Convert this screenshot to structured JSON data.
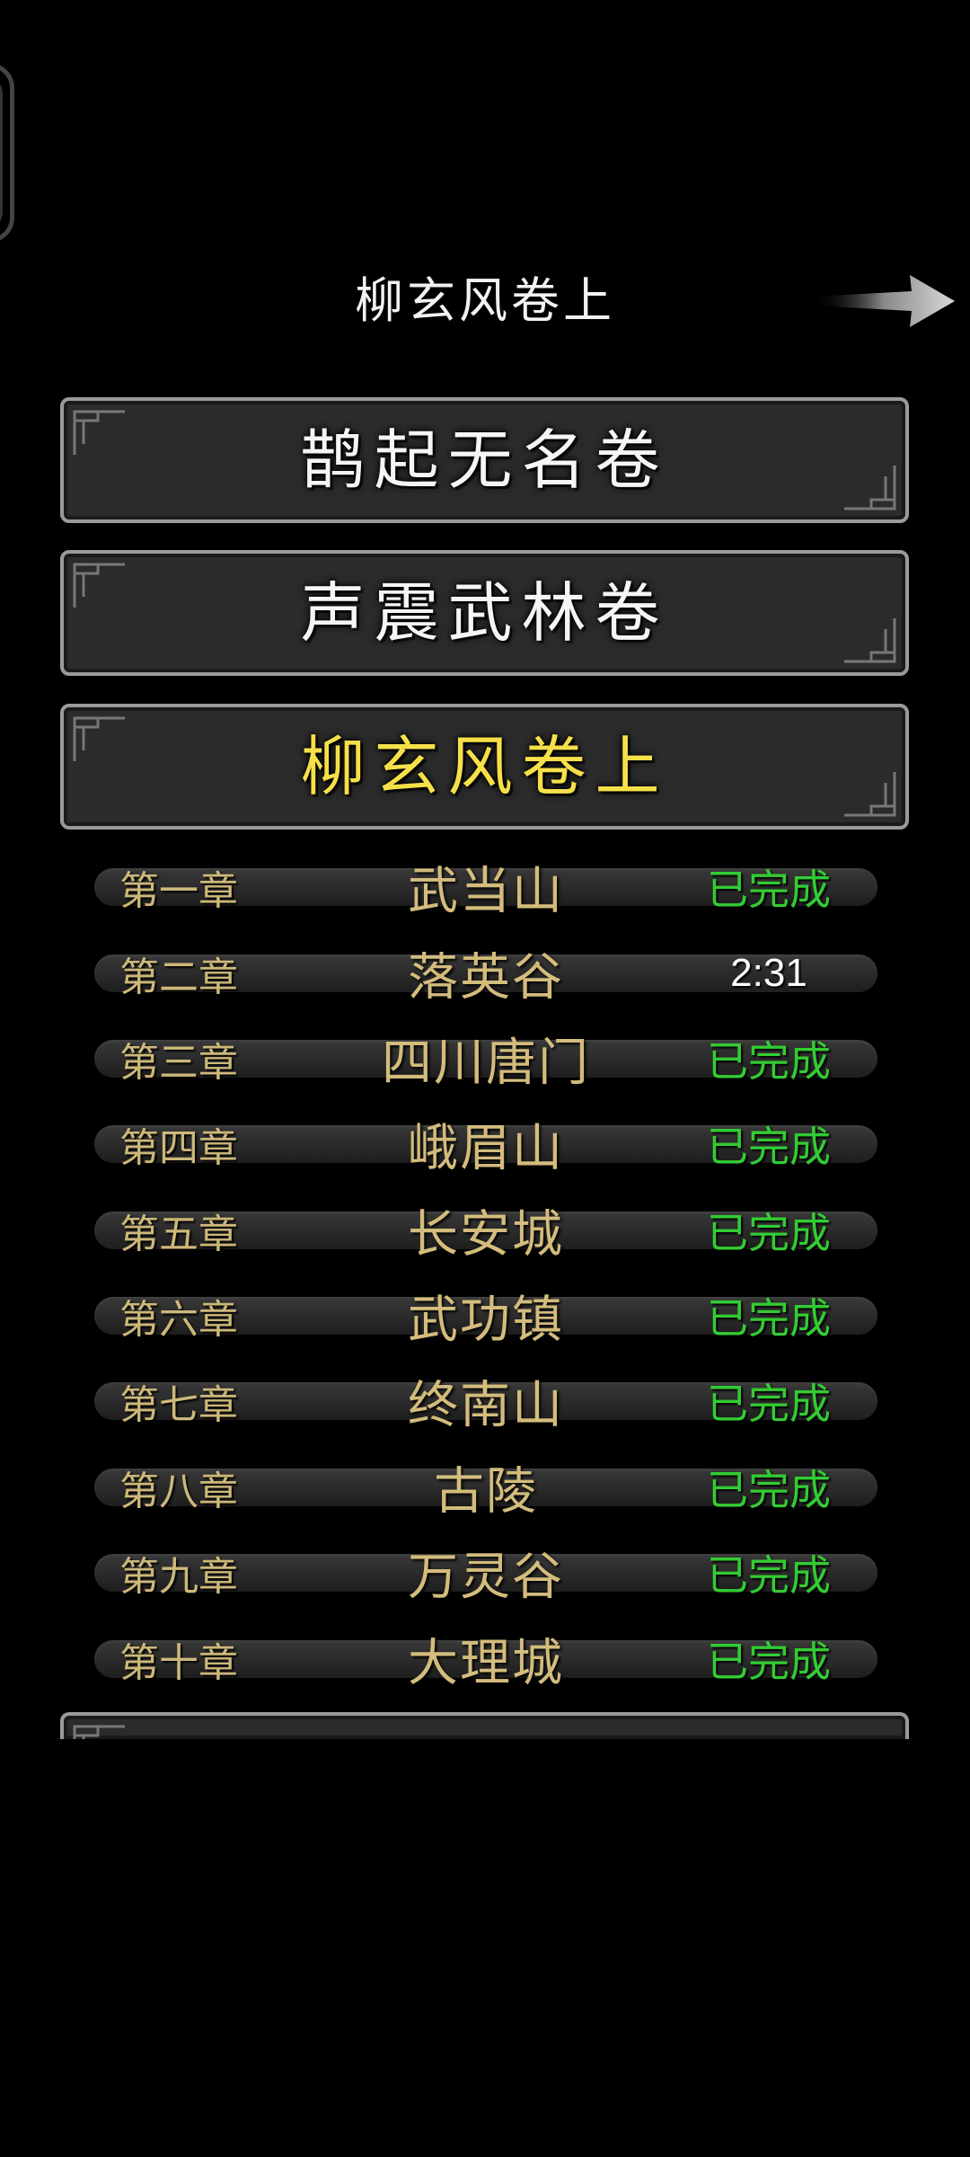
{
  "header": {
    "title": "柳玄风卷上",
    "next_icon": "arrow-right-icon"
  },
  "volumes": [
    {
      "label": "鹊起无名卷",
      "active": false
    },
    {
      "label": "声震武林卷",
      "active": false
    },
    {
      "label": "柳玄风卷上",
      "active": true
    }
  ],
  "chapters": [
    {
      "number": "第一章",
      "name": "武当山",
      "status": "已完成"
    },
    {
      "number": "第二章",
      "name": "落英谷",
      "status": "2:31"
    },
    {
      "number": "第三章",
      "name": "四川唐门",
      "status": "已完成"
    },
    {
      "number": "第四章",
      "name": "峨眉山",
      "status": "已完成"
    },
    {
      "number": "第五章",
      "name": "长安城",
      "status": "已完成"
    },
    {
      "number": "第六章",
      "name": "武功镇",
      "status": "已完成"
    },
    {
      "number": "第七章",
      "name": "终南山",
      "status": "已完成"
    },
    {
      "number": "第八章",
      "name": "古陵",
      "status": "已完成"
    },
    {
      "number": "第九章",
      "name": "万灵谷",
      "status": "已完成"
    },
    {
      "number": "第十章",
      "name": "大理城",
      "status": "已完成"
    }
  ],
  "colors": {
    "active_volume": "#f6e04a",
    "completed": "#33cc33",
    "chapter_text": "#cdb87a"
  }
}
